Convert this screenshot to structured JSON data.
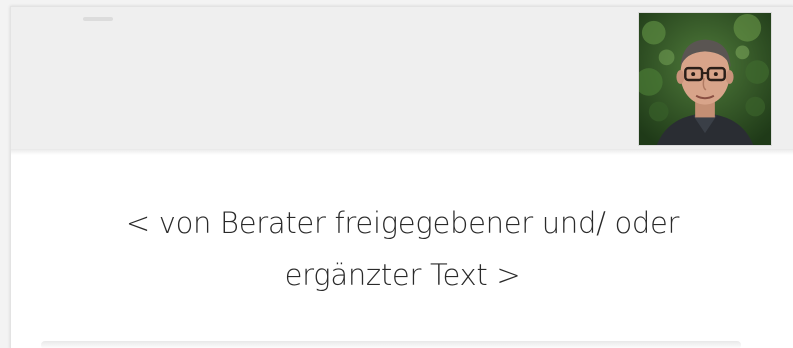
{
  "message": {
    "line1": "< von Berater freigegebener und/ oder",
    "line2": "ergänzter Text >"
  },
  "avatar": {
    "icon": "person-photo"
  },
  "colors": {
    "header_bg": "#efefef",
    "card_bg": "#ffffff",
    "text": "#2a2a2a"
  }
}
